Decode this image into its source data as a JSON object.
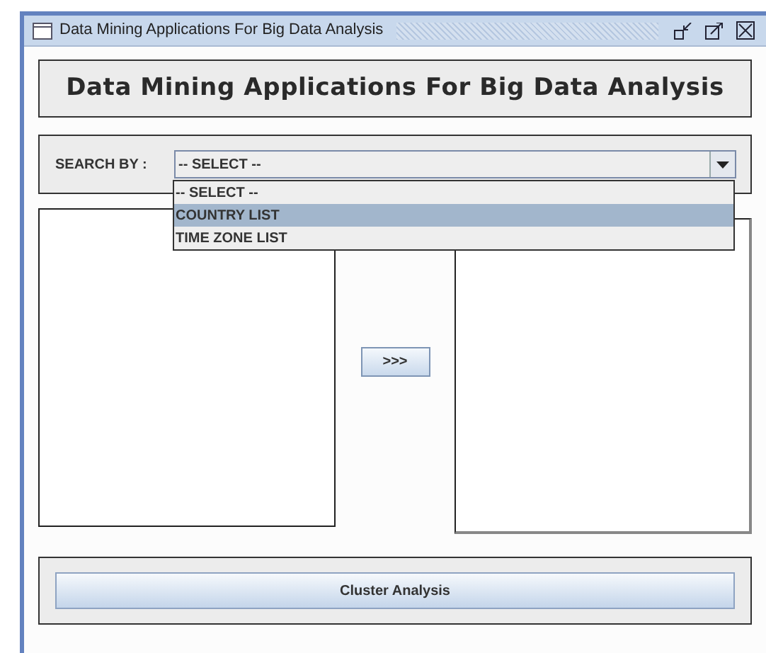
{
  "window": {
    "title": "Data Mining Applications For Big Data Analysis"
  },
  "header": {
    "title": "Data Mining Applications For Big Data Analysis"
  },
  "search": {
    "label": "SEARCH BY :",
    "value": "-- SELECT --",
    "expanded": true,
    "options": [
      {
        "label": "-- SELECT --",
        "highlighted": false
      },
      {
        "label": "COUNTRY LIST",
        "highlighted": true
      },
      {
        "label": "TIME ZONE LIST",
        "highlighted": false
      }
    ]
  },
  "transfer_button": ">>>",
  "cluster_button": "Cluster Analysis"
}
